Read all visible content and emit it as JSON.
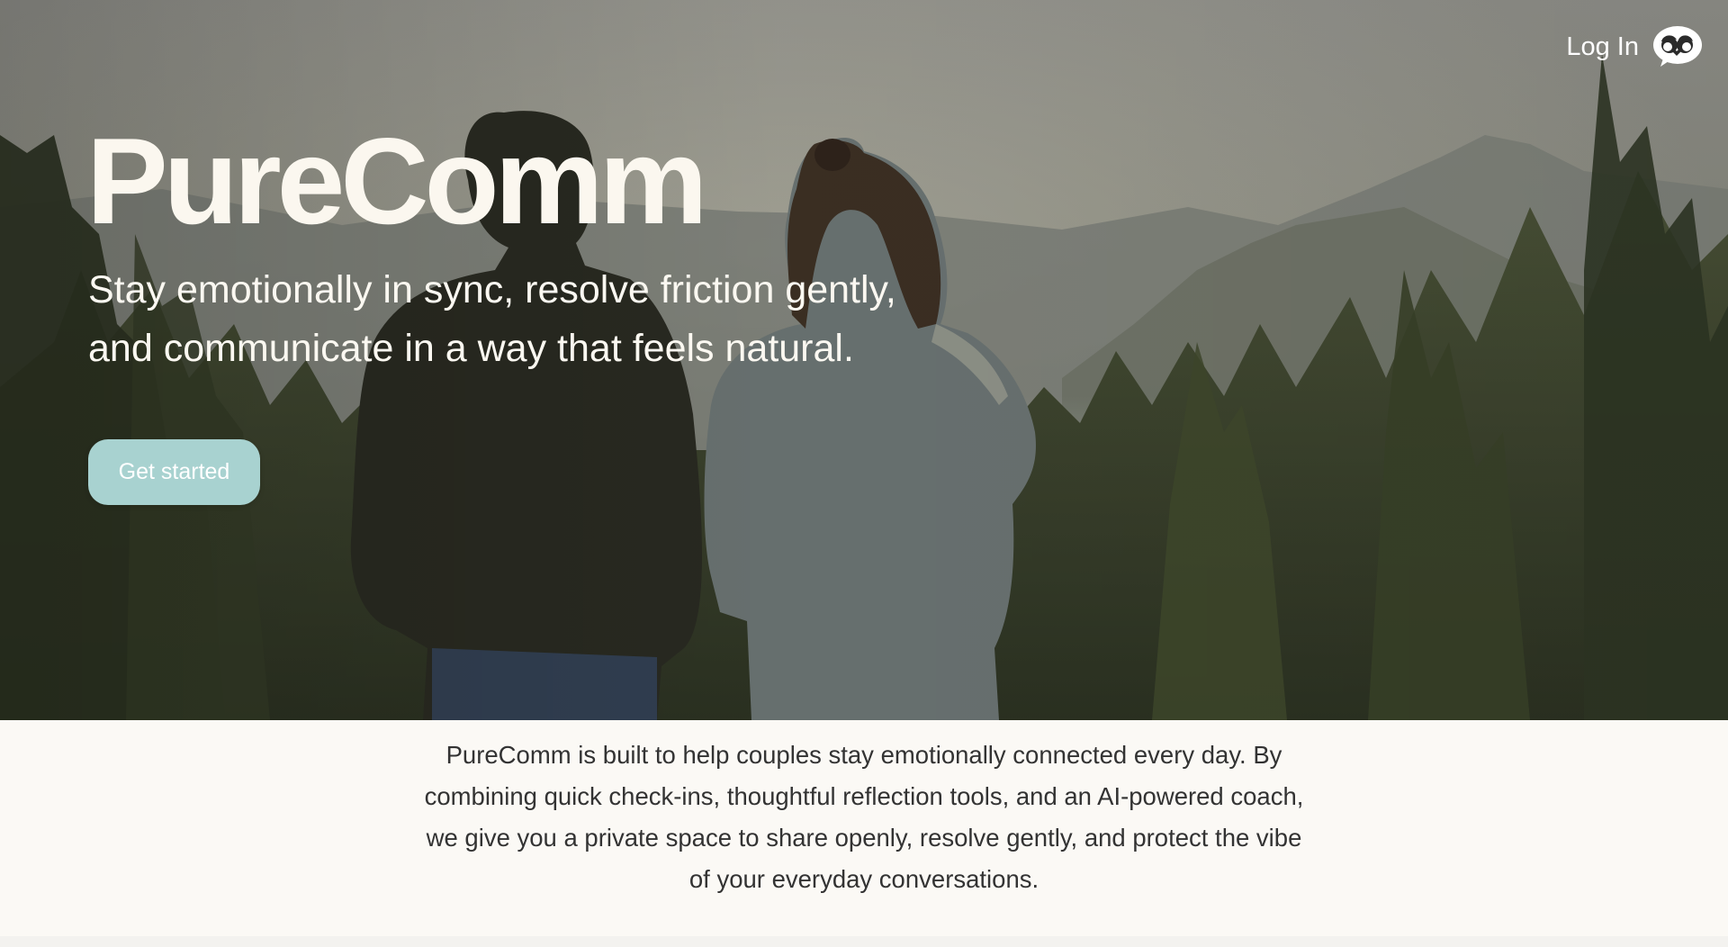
{
  "hero": {
    "title": "PureComm",
    "tagline_lines": [
      "Stay emotionally in sync, resolve friction gently,",
      "and communicate in a way that feels natural."
    ],
    "cta_label": "Get started"
  },
  "header": {
    "login_label": "Log In",
    "logo_icon": "couple-logo-icon"
  },
  "about": {
    "lines": [
      "PureComm is built to help couples stay emotionally connected every day. By",
      "combining quick check-ins, thoughtful reflection tools, and an AI-powered coach,",
      "we give you a private space to share openly, resolve gently, and protect the vibe",
      "of your everyday conversations."
    ]
  },
  "colors": {
    "cta_background": "#a8d2d0",
    "hero_text": "#fbf7ef",
    "about_background": "#fbf9f5",
    "about_text": "#333333"
  }
}
